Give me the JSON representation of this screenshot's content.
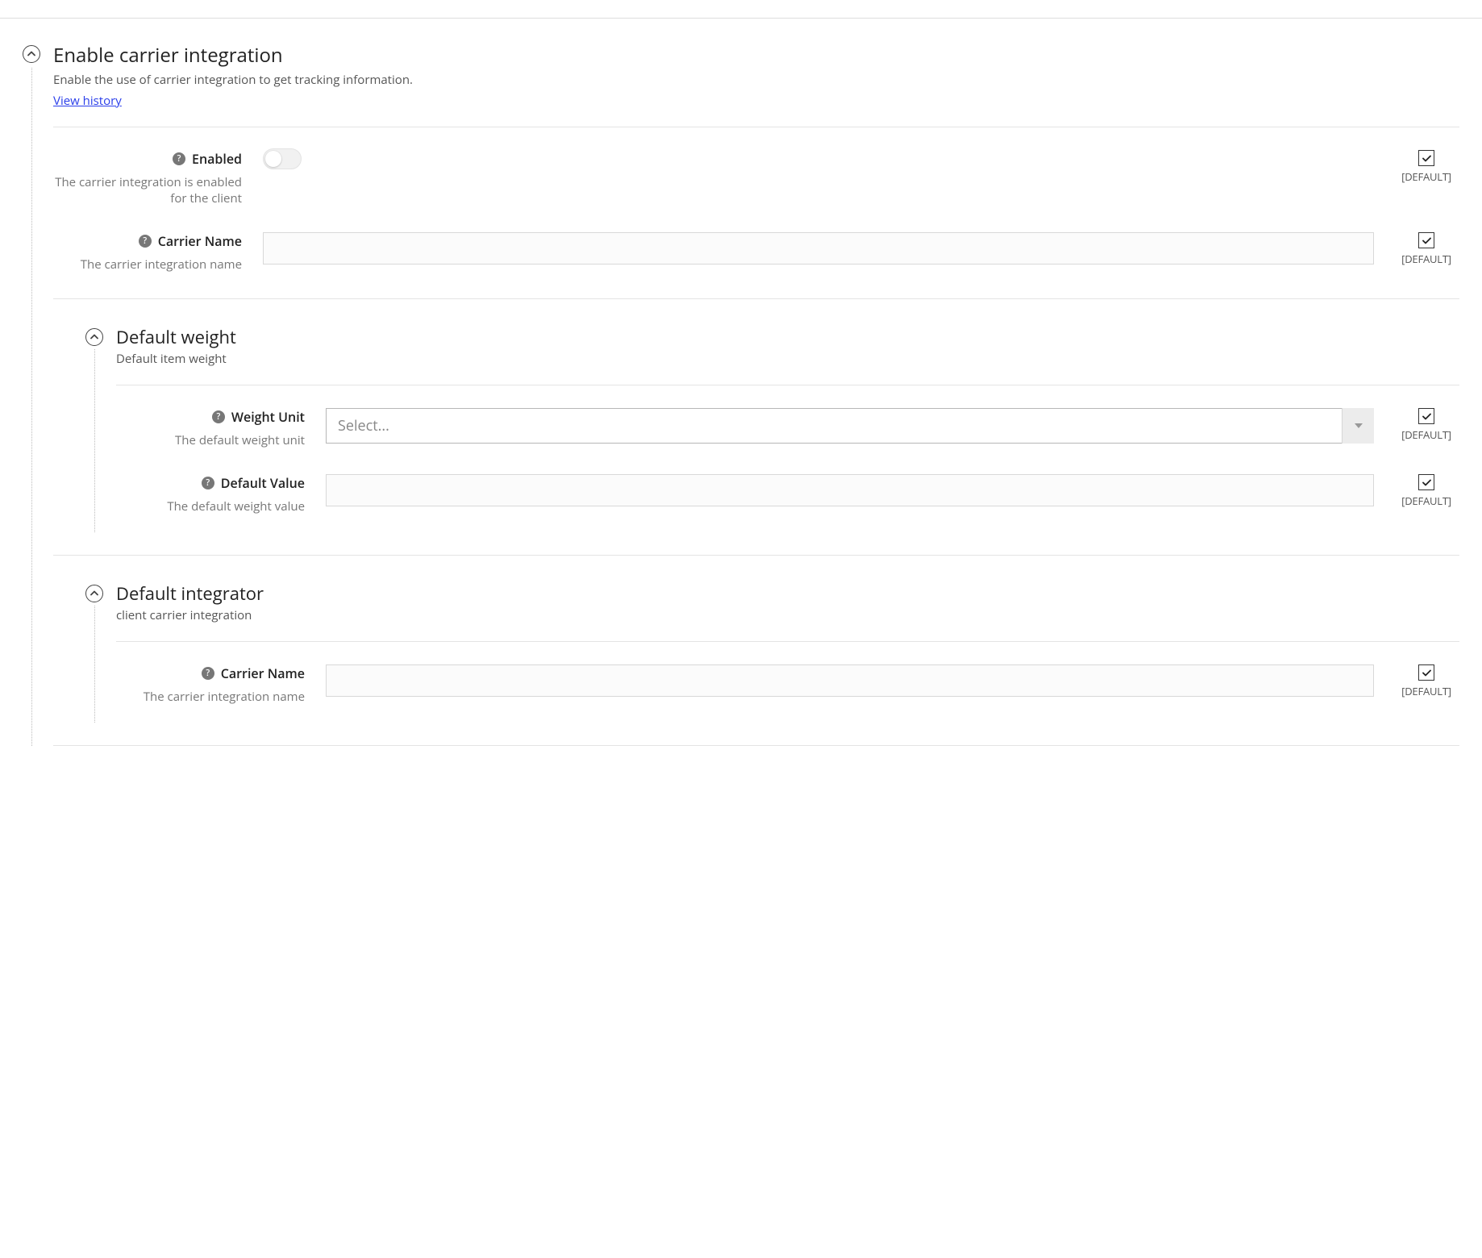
{
  "section": {
    "title": "Enable carrier integration",
    "description": "Enable the use of carrier integration to get tracking information.",
    "view_history": "View history",
    "default_label": "[DEFAULT]",
    "fields": {
      "enabled": {
        "label": "Enabled",
        "help": "The carrier integration is enabled for the client",
        "checked": true
      },
      "carrier_name": {
        "label": "Carrier Name",
        "help": "The carrier integration name",
        "value": "",
        "checked": true
      }
    },
    "default_weight": {
      "title": "Default weight",
      "description": "Default item weight",
      "fields": {
        "weight_unit": {
          "label": "Weight Unit",
          "help": "The default weight unit",
          "placeholder": "Select...",
          "checked": true
        },
        "default_value": {
          "label": "Default Value",
          "help": "The default weight value",
          "value": "",
          "checked": true
        }
      }
    },
    "default_integrator": {
      "title": "Default integrator",
      "description": "client carrier integration",
      "fields": {
        "carrier_name": {
          "label": "Carrier Name",
          "help": "The carrier integration name",
          "value": "",
          "checked": true
        }
      }
    }
  }
}
